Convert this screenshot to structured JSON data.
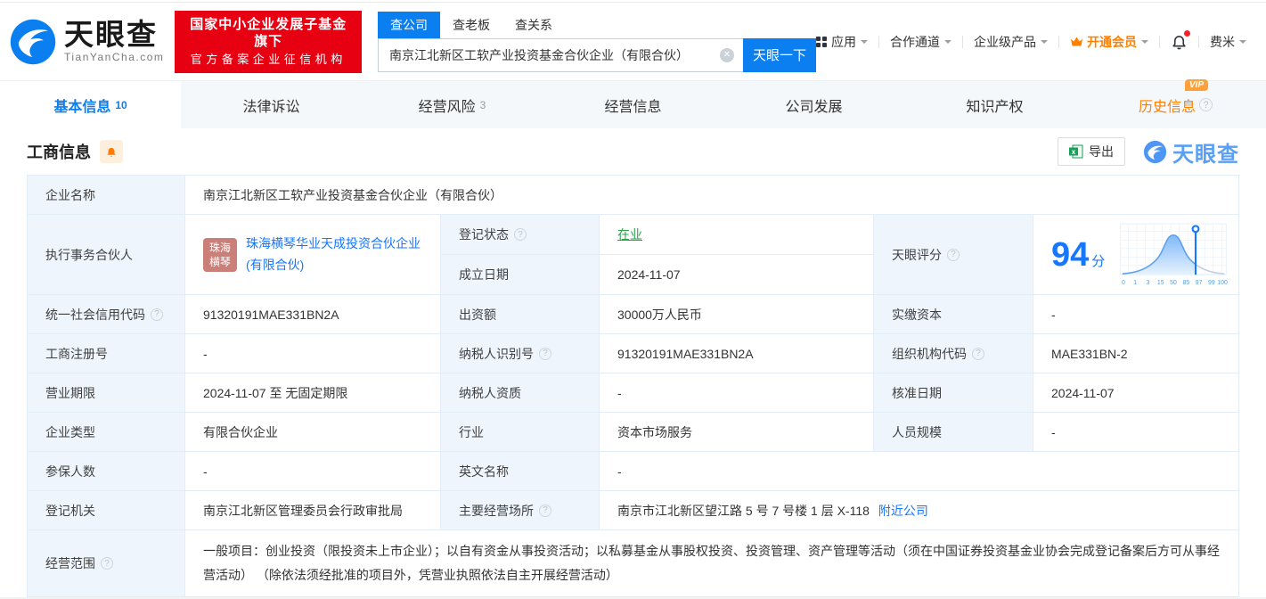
{
  "brand": {
    "name": "天眼查",
    "domain": "TianYanCha.com",
    "badge_line1": "国家中小企业发展子基金旗下",
    "badge_line2": "官方备案企业征信机构"
  },
  "search": {
    "tabs": [
      {
        "label": "查公司",
        "active": true
      },
      {
        "label": "查老板",
        "active": false
      },
      {
        "label": "查关系",
        "active": false
      }
    ],
    "value": "南京江北新区工软产业投资基金合伙企业（有限合伙）",
    "button": "天眼一下"
  },
  "nav": {
    "apps": "应用",
    "partner_channel": "合作通道",
    "enterprise_products": "企业级产品",
    "vip": "开通会员",
    "user": "费米"
  },
  "tabs": [
    {
      "label": "基本信息",
      "count": "10",
      "active": true
    },
    {
      "label": "法律诉讼",
      "count": "",
      "active": false
    },
    {
      "label": "经营风险",
      "count": "3",
      "active": false
    },
    {
      "label": "经营信息",
      "count": "",
      "active": false
    },
    {
      "label": "公司发展",
      "count": "",
      "active": false
    },
    {
      "label": "知识产权",
      "count": "",
      "active": false
    },
    {
      "label": "历史信息",
      "count": "",
      "active": false,
      "vip": true
    }
  ],
  "vip_badge": "VIP",
  "section": {
    "title": "工商信息",
    "export": "导出",
    "watermark": "天眼查"
  },
  "info": {
    "company_name": {
      "label": "企业名称",
      "value": "南京江北新区工软产业投资基金合伙企业（有限合伙）"
    },
    "managing_partner": {
      "label": "执行事务合伙人",
      "avatar_text": "珠海横琴",
      "value": "珠海横琴华业天成投资合伙企业(有限合伙)"
    },
    "reg_status": {
      "label": "登记状态",
      "value": "在业"
    },
    "establish_date": {
      "label": "成立日期",
      "value": "2024-11-07"
    },
    "score": {
      "label": "天眼评分",
      "value": "94",
      "unit": "分",
      "ticks": [
        "0",
        "1",
        "3",
        "15",
        "50",
        "85",
        "97",
        "99",
        "100"
      ]
    },
    "credit_code": {
      "label": "统一社会信用代码",
      "value": "91320191MAE331BN2A"
    },
    "contributed_capital": {
      "label": "出资额",
      "value": "30000万人民币"
    },
    "paid_in_capital": {
      "label": "实缴资本",
      "value": "-"
    },
    "reg_no": {
      "label": "工商注册号",
      "value": "-"
    },
    "taxpayer_no": {
      "label": "纳税人识别号",
      "value": "91320191MAE331BN2A"
    },
    "org_code": {
      "label": "组织机构代码",
      "value": "MAE331BN-2"
    },
    "business_term": {
      "label": "营业期限",
      "value": "2024-11-07 至 无固定期限"
    },
    "taxpayer_qualification": {
      "label": "纳税人资质",
      "value": "-"
    },
    "approval_date": {
      "label": "核准日期",
      "value": "2024-11-07"
    },
    "enterprise_type": {
      "label": "企业类型",
      "value": "有限合伙企业"
    },
    "industry": {
      "label": "行业",
      "value": "资本市场服务"
    },
    "staff_size": {
      "label": "人员规模",
      "value": "-"
    },
    "insured_count": {
      "label": "参保人数",
      "value": "-"
    },
    "english_name": {
      "label": "英文名称",
      "value": "-"
    },
    "reg_authority": {
      "label": "登记机关",
      "value": "南京江北新区管理委员会行政审批局"
    },
    "business_address": {
      "label": "主要经营场所",
      "value": "南京市江北新区望江路 5 号 7 号楼 1 层 X-118",
      "link": "附近公司"
    },
    "business_scope": {
      "label": "经营范围",
      "value": "一般项目：创业投资（限投资未上市企业）；以自有资金从事投资活动；以私募基金从事股权投资、投资管理、资产管理等活动（须在中国证券投资基金业协会完成登记备案后方可从事经营活动） （除依法须经批准的项目外，凭营业执照依法自主开展经营活动）"
    }
  },
  "chart_data": {
    "type": "area",
    "title": "天眼评分",
    "x_ticks": [
      0,
      1,
      3,
      15,
      50,
      85,
      97,
      99,
      100
    ],
    "marker_value": 94,
    "description": "bell-shaped score distribution curve with vertical marker at score 94",
    "grid": true
  },
  "colors": {
    "primary_blue": "#0b7ef0",
    "link_blue": "#1677ff",
    "badge_red": "#e60012",
    "status_green": "#2ba24c",
    "vip_orange": "#ff8000",
    "label_cell_bg": "#eef5fc",
    "table_border": "#e3edf8"
  }
}
